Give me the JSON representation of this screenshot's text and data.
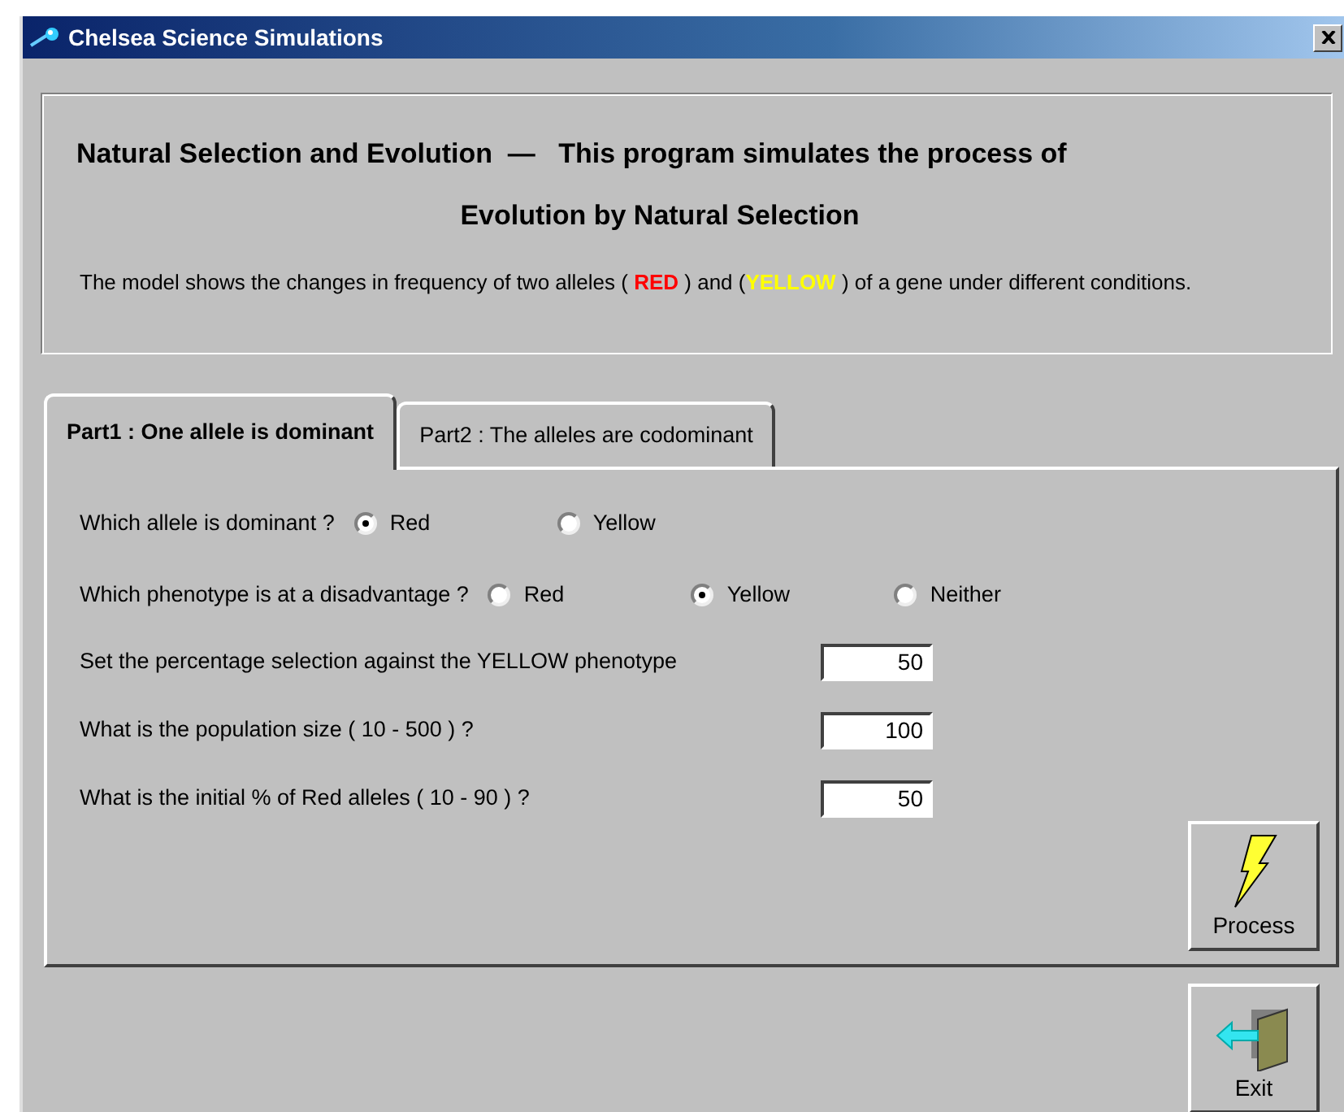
{
  "window": {
    "title": "Chelsea Science Simulations"
  },
  "intro": {
    "heading": "Natural Selection and Evolution  —   This program simulates the process of",
    "heading_line2": "Evolution by Natural Selection",
    "description": [
      {
        "text": "The model shows the changes in frequency of two alleles ( "
      },
      {
        "text": "RED",
        "color": "#ff0000"
      },
      {
        "text": "  ) and ("
      },
      {
        "text": "YELLOW",
        "color": "#ffff00"
      },
      {
        "text": "  ) of a gene under different conditions."
      }
    ]
  },
  "tabs": [
    {
      "label": "Part1 : One allele is dominant",
      "selected": true
    },
    {
      "label": "Part2 : The alleles are codominant",
      "selected": false
    }
  ],
  "questions": [
    {
      "label": "Which allele is dominant ?",
      "options": [
        {
          "label": "Red",
          "selected": true
        },
        {
          "label": "Yellow",
          "selected": false
        }
      ]
    },
    {
      "label": "Which phenotype is at a disadvantage ?",
      "options": [
        {
          "label": "Red",
          "selected": false
        },
        {
          "label": "Yellow",
          "selected": true
        },
        {
          "label": "Neither",
          "selected": false
        }
      ]
    }
  ],
  "fields": [
    {
      "label": "Set the percentage selection against the YELLOW phenotype",
      "value": "50"
    },
    {
      "label": "What is the population size ( 10 - 500 )  ?",
      "value": "100"
    },
    {
      "label": "What is the initial % of Red alleles ( 10 - 90 ) ?",
      "value": "50"
    }
  ],
  "buttons": [
    {
      "label": "Process",
      "kind": "process"
    },
    {
      "label": "Exit",
      "kind": "exit"
    }
  ]
}
